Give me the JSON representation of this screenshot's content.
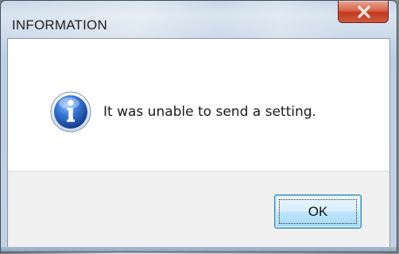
{
  "window": {
    "title": "INFORMATION",
    "close_icon": "close-x-icon"
  },
  "message": {
    "icon": "info-icon",
    "text": "It was unable to send a setting."
  },
  "buttons": {
    "ok_label": "OK"
  },
  "colors": {
    "close_button": "#d0472a",
    "ok_button_border": "#3c7fb1",
    "info_icon_blue": "#2a63c7"
  }
}
